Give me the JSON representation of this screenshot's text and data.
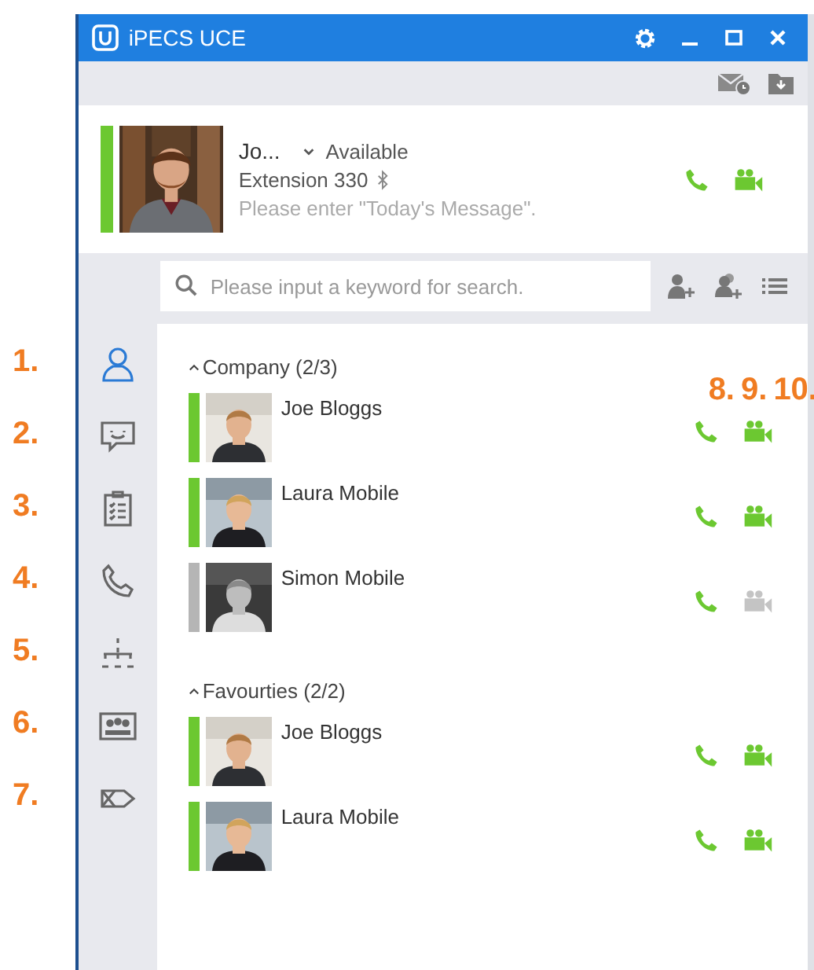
{
  "window": {
    "title": "iPECS UCE"
  },
  "profile": {
    "available": true,
    "name": "Jo...",
    "status": "Available",
    "extension": "Extension 330",
    "message": {
      "placeholder": "Please enter \"Today's Message\"."
    }
  },
  "search": {
    "placeholder": "Please input a keyword for search."
  },
  "sidebar": {
    "items": [
      {
        "kind": "contacts",
        "selected": true
      },
      {
        "kind": "chat",
        "selected": false
      },
      {
        "kind": "tasks",
        "selected": false
      },
      {
        "kind": "calls",
        "selected": false
      },
      {
        "kind": "organization",
        "selected": false
      },
      {
        "kind": "conference",
        "selected": false
      },
      {
        "kind": "messages",
        "selected": false
      }
    ]
  },
  "groups": [
    {
      "title": "Company (2/3)",
      "expanded": true,
      "contacts": [
        {
          "name": "Joe Bloggs",
          "available": true,
          "video_available": true
        },
        {
          "name": "Laura Mobile",
          "available": true,
          "video_available": true
        },
        {
          "name": "Simon Mobile",
          "available": false,
          "video_available": false
        }
      ]
    },
    {
      "title": "Favourties (2/2)",
      "expanded": true,
      "contacts": [
        {
          "name": "Joe Bloggs",
          "available": true,
          "video_available": true
        },
        {
          "name": "Laura Mobile",
          "available": true,
          "video_available": true
        }
      ]
    }
  ],
  "annotations": {
    "sidebar": [
      "1.",
      "2.",
      "3.",
      "4.",
      "5.",
      "6.",
      "7."
    ],
    "toolbar": [
      "8.",
      "9.",
      "10."
    ]
  }
}
